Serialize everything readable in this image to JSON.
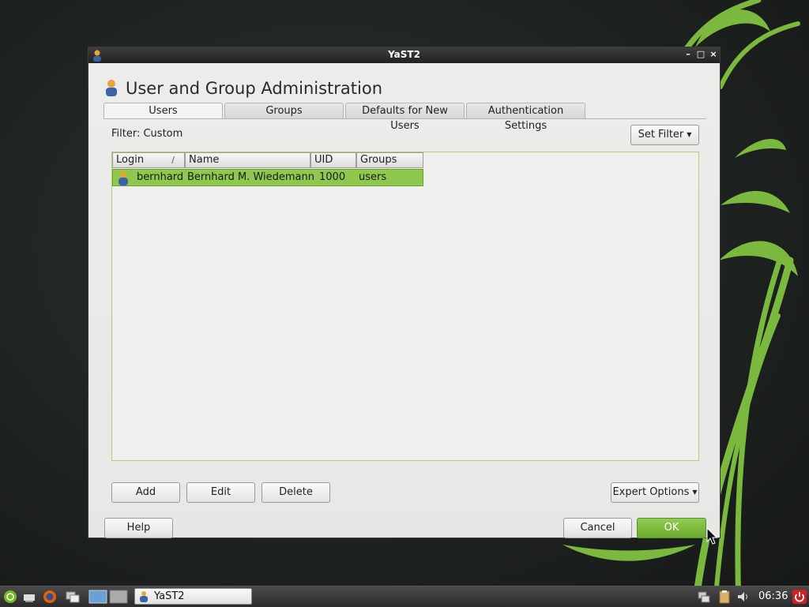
{
  "window": {
    "title": "YaST2",
    "minimize_glyph": "–",
    "maximize_glyph": "□",
    "close_glyph": "×"
  },
  "header": {
    "title": "User and Group Administration",
    "icon": "users-icon"
  },
  "tabs": [
    {
      "label": "Users",
      "active": true
    },
    {
      "label": "Groups",
      "active": false
    },
    {
      "label": "Defaults for New Users",
      "active": false
    },
    {
      "label": "Authentication Settings",
      "active": false
    }
  ],
  "filter": {
    "label": "Filter: Custom",
    "set_filter_label": "Set Filter"
  },
  "table": {
    "columns": [
      "Login",
      "Name",
      "UID",
      "Groups"
    ],
    "sort_indicator": "∕",
    "rows": [
      {
        "login": "bernhard",
        "name": "Bernhard M. Wiedemann",
        "uid": "1000",
        "groups": "users",
        "selected": true
      }
    ]
  },
  "actions": {
    "add": "Add",
    "edit": "Edit",
    "delete": "Delete",
    "expert_options": "Expert Options"
  },
  "footer": {
    "help": "Help",
    "cancel": "Cancel",
    "ok": "OK"
  },
  "taskbar": {
    "task_label": "YaST2",
    "clock": "06:36",
    "icons": [
      "opensuse-menu-icon",
      "show-desktop-icon",
      "firefox-icon",
      "file-manager-icon",
      "workspace-1-icon",
      "workspace-2-icon",
      "network-icon",
      "clipboard-icon",
      "volume-icon",
      "power-icon"
    ]
  },
  "colors": {
    "accent_green": "#7ab83e",
    "selection_green": "#8fc84f",
    "titlebar": "#2b2b2b"
  }
}
